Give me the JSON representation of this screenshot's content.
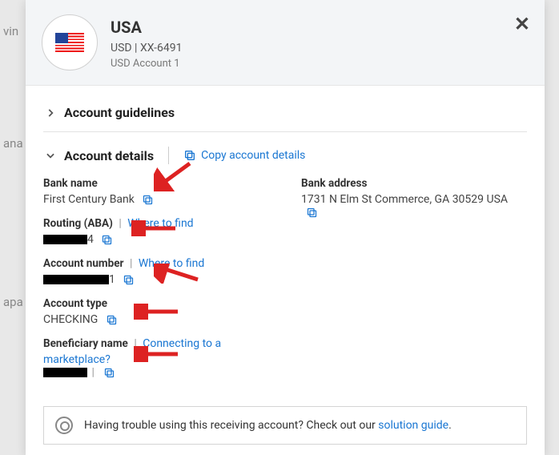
{
  "header": {
    "country": "USA",
    "meta": "USD | XX-6491",
    "sub": "USD Account 1"
  },
  "sections": {
    "guidelines": "Account guidelines",
    "details": "Account details",
    "copy_all": "Copy account details"
  },
  "fields": {
    "bank_name": {
      "label": "Bank name",
      "value": "First Century Bank"
    },
    "routing": {
      "label": "Routing (ABA)",
      "hint": "Where to find",
      "tail": "4"
    },
    "account_number": {
      "label": "Account number",
      "hint": "Where to find",
      "tail": "1"
    },
    "account_type": {
      "label": "Account type",
      "value": "CHECKING"
    },
    "beneficiary": {
      "label": "Beneficiary name",
      "hint": "Connecting to a marketplace?"
    },
    "bank_address": {
      "label": "Bank address",
      "value": "1731 N Elm St Commerce, GA 30529 USA"
    }
  },
  "info": {
    "text": "Having trouble using this receiving account? Check out our ",
    "link": "solution guide",
    "period": "."
  }
}
